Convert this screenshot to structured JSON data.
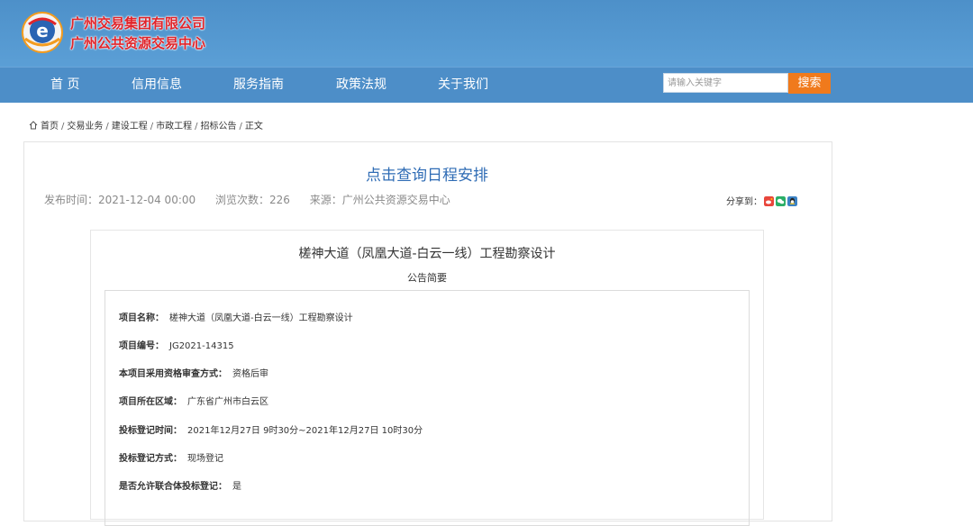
{
  "brand": {
    "line1": "广州交易集团有限公司",
    "line2": "广州公共资源交易中心",
    "color": "#e0242a"
  },
  "nav": {
    "items": [
      "首 页",
      "信用信息",
      "服务指南",
      "政策法规",
      "关于我们"
    ],
    "search_placeholder": "请输入关键字",
    "search_button": "搜索"
  },
  "breadcrumb": {
    "items": [
      "首页",
      "交易业务",
      "建设工程",
      "市政工程",
      "招标公告",
      "正文"
    ],
    "separator": "/"
  },
  "article": {
    "title": "点击查询日程安排",
    "publish_time": "发布时间：2021-12-04 00:00",
    "views": "浏览次数：226",
    "source": "来源：广州公共资源交易中心",
    "share_label": "分享到："
  },
  "notice": {
    "title": "槎神大道（凤凰大道-白云一线）工程勘察设计",
    "subtitle": "公告简要",
    "fields": [
      {
        "key": "项目名称：",
        "value": "槎神大道（凤凰大道-白云一线）工程勘察设计"
      },
      {
        "key": "项目编号：",
        "value": "JG2021-14315"
      },
      {
        "key": "本项目采用资格审查方式：",
        "value": "资格后审"
      },
      {
        "key": "项目所在区域：",
        "value": "广东省广州市白云区"
      },
      {
        "key": "投标登记时间：",
        "value": "2021年12月27日 9时30分~2021年12月27日 10时30分"
      },
      {
        "key": "投标登记方式：",
        "value": "现场登记"
      },
      {
        "key": "是否允许联合体投标登记：",
        "value": "是"
      }
    ]
  },
  "colors": {
    "header_bg": "#4d90c9",
    "nav_bg": "#4d8ec8",
    "search_button_bg": "#f07a1c",
    "title_blue": "#2f6cb5"
  }
}
